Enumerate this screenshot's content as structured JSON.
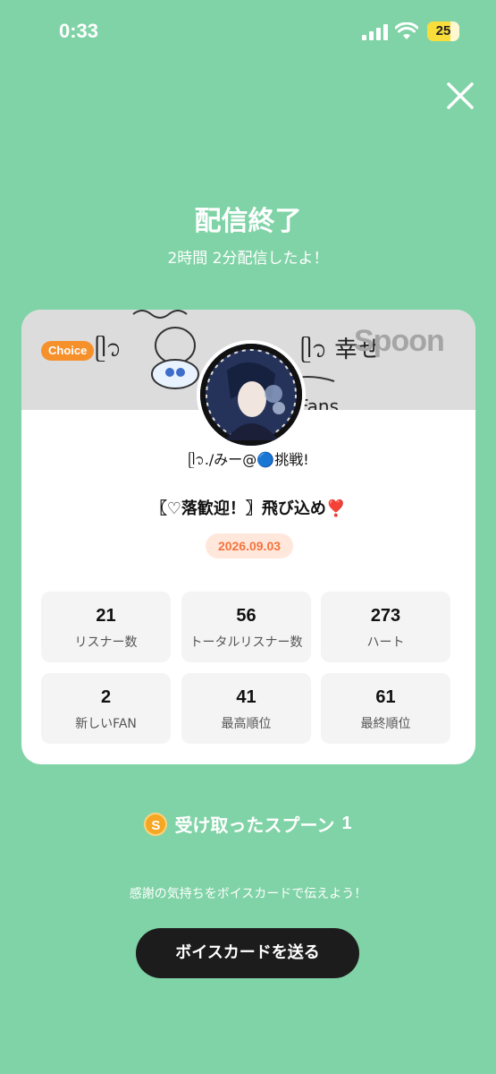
{
  "status_bar": {
    "time": "0:33",
    "battery_level": "25"
  },
  "header": {
    "title": "配信終了",
    "subtitle": "2時間 2分配信したよ！"
  },
  "card": {
    "badge": "Choice",
    "brand": "Spoon",
    "banner_text_left": "ᥫ᭡",
    "banner_text_right": "ᥫ᭡ 幸せ",
    "nickname": "ᥫ᭡./みー@🔵挑戦!",
    "stream_title": "〖♡落歓迎！〗飛び込め❣️",
    "date": "2026.09.03",
    "stats": [
      {
        "value": "21",
        "label": "リスナー数"
      },
      {
        "value": "56",
        "label": "トータルリスナー数"
      },
      {
        "value": "273",
        "label": "ハート"
      },
      {
        "value": "2",
        "label": "新しいFAN"
      },
      {
        "value": "41",
        "label": "最高順位"
      },
      {
        "value": "61",
        "label": "最終順位"
      }
    ]
  },
  "spoons": {
    "icon": "spoon-coin-icon",
    "icon_letter": "S",
    "label": "受け取ったスプーン",
    "count": "1"
  },
  "footer": {
    "thanks_text": "感謝の気持ちをボイスカードで伝えよう！",
    "button_label": "ボイスカードを送る"
  },
  "colors": {
    "background": "#80d3a7",
    "accent": "#f6902a",
    "date_text": "#f4743c",
    "button": "#1c1c1c"
  }
}
